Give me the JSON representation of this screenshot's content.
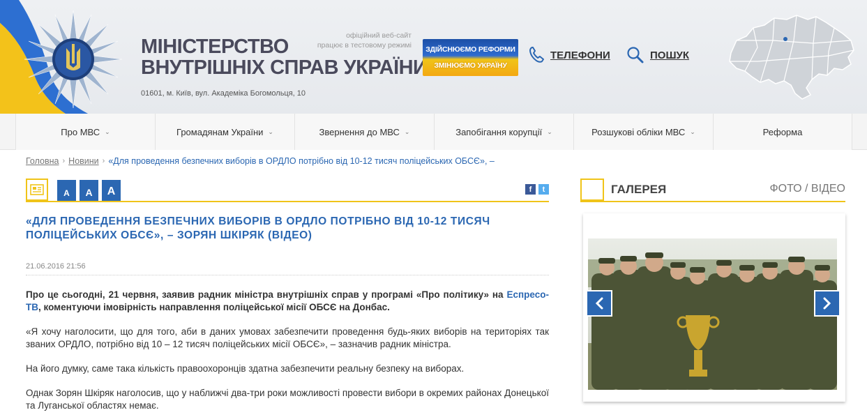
{
  "header": {
    "title_line1": "МІНІСТЕРСТВО",
    "title_line2": "ВНУТРІШНІХ СПРАВ УКРАЇНИ",
    "address": "01601, м. Київ, вул. Академіка Богомольця, 10",
    "official_line1": "офіційний веб-сайт",
    "official_line2": "працює в тестовому режимі",
    "reform_line1": "ЗДІЙСНЮЄМО РЕФОРМИ",
    "reform_line2": "ЗМІНЮЄМО УКРАЇНУ",
    "phones_label": "ТЕЛЕФОНИ",
    "search_label": "ПОШУК"
  },
  "nav": {
    "items": [
      {
        "label": "Про МВС",
        "has_dropdown": true
      },
      {
        "label": "Громадянам України",
        "has_dropdown": true
      },
      {
        "label": "Звернення до МВС",
        "has_dropdown": true
      },
      {
        "label": "Запобігання корупції",
        "has_dropdown": true
      },
      {
        "label": "Розшукові обліки МВС",
        "has_dropdown": true
      },
      {
        "label": "Реформа",
        "has_dropdown": false
      }
    ]
  },
  "breadcrumb": {
    "home": "Головна",
    "news": "Новини",
    "current": "«Для проведення безпечних виборів в ОРДЛО потрібно від 10-12 тисяч поліцейських ОБСЄ», –"
  },
  "toolbar": {
    "font_small": "А",
    "font_medium": "А",
    "font_large": "А",
    "facebook": "f",
    "twitter": "t"
  },
  "article": {
    "title": "«ДЛЯ ПРОВЕДЕННЯ БЕЗПЕЧНИХ ВИБОРІВ В ОРДЛО ПОТРІБНО ВІД 10-12 ТИСЯЧ ПОЛІЦЕЙСЬКИХ ОБСЄ», – ЗОРЯН ШКІРЯК (ВІДЕО)",
    "date": "21.06.2016 21:56",
    "lead_before": "Про це сьогодні, 21 червня, заявив радник міністра внутрішніх справ у програмі «Про політику» на ",
    "lead_link": "Еспресо-ТВ",
    "lead_after": ", коментуючи імовірність направлення поліцейської місії ОБСЄ на Донбас.",
    "p1": "«Я хочу наголосити, що для того, аби в даних умовах забезпечити проведення будь-яких виборів на територіях так званих ОРДЛО, потрібно від 10 – 12 тисяч поліцейських місії ОБСЄ», – зазначив радник міністра.",
    "p2": "На його думку, саме така кількість правоохоронців здатна забезпечити реальну безпеку на виборах.",
    "p3": "Однак Зорян Шкіряк наголосив, що у наближчі два-три роки можливості провести вибори в окремих районах Донецької та Луганської областях немає."
  },
  "gallery": {
    "title": "ГАЛЕРЕЯ",
    "tabs": "ФОТО / ВІДЕО"
  },
  "colors": {
    "accent_blue": "#2b67b2",
    "accent_yellow": "#f0c419",
    "title_gray": "#4a4a5c"
  }
}
